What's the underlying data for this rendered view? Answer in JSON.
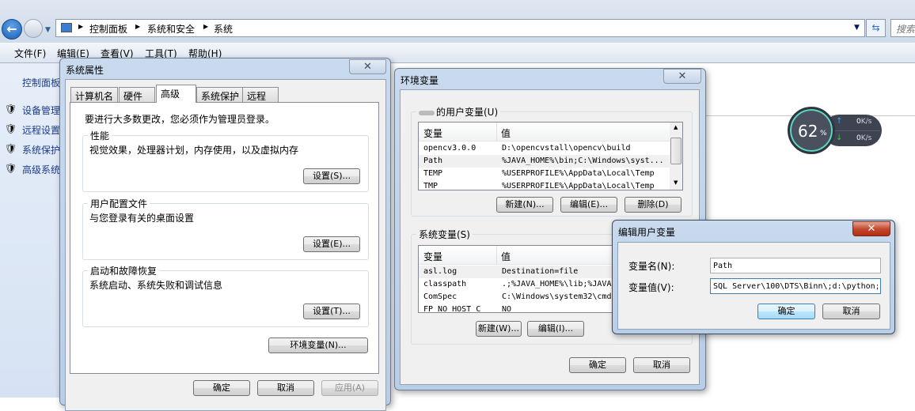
{
  "explorer": {
    "breadcrumb": [
      "控制面板",
      "系统和安全",
      "系统"
    ],
    "search_placeholder": "搜索",
    "menu": [
      "文件(F)",
      "编辑(E)",
      "查看(V)",
      "工具(T)",
      "帮助(H)"
    ],
    "left_pane": {
      "home": "控制面板",
      "items": [
        "设备管理",
        "远程设置",
        "系统保护",
        "高级系统"
      ]
    }
  },
  "net_widget": {
    "cpu_percent": "62",
    "percent_sign": "%",
    "upload": "0",
    "download": "0",
    "unit": "K/s",
    "accent": "#4fd1c5"
  },
  "system_properties": {
    "title": "系统属性",
    "tabs": [
      "计算机名",
      "硬件",
      "高级",
      "系统保护",
      "远程"
    ],
    "selected_tab": "高级",
    "admin_note": "要进行大多数更改，您必须作为管理员登录。",
    "groups": [
      {
        "label": "性能",
        "desc": "视觉效果，处理器计划，内存使用，以及虚拟内存",
        "button": "设置(S)..."
      },
      {
        "label": "用户配置文件",
        "desc": "与您登录有关的桌面设置",
        "button": "设置(E)..."
      },
      {
        "label": "启动和故障恢复",
        "desc": "系统启动、系统失败和调试信息",
        "button": "设置(T)..."
      }
    ],
    "env_button": "环境变量(N)...",
    "ok": "确定",
    "cancel": "取消",
    "apply": "应用(A)"
  },
  "env_vars": {
    "title": "环境变量",
    "user_label": "的用户变量(U)",
    "columns": [
      "变量",
      "值"
    ],
    "user_vars": [
      [
        "opencv3.0.0",
        "D:\\opencvstall\\opencv\\build"
      ],
      [
        "Path",
        "%JAVA_HOME%\\bin;C:\\Windows\\syst..."
      ],
      [
        "TEMP",
        "%USERPROFILE%\\AppData\\Local\\Temp"
      ],
      [
        "TMP",
        "%USERPROFILE%\\AppData\\Local\\Temp"
      ]
    ],
    "user_buttons": [
      "新建(N)...",
      "编辑(E)...",
      "删除(D)"
    ],
    "system_label": "系统变量(S)",
    "system_vars": [
      [
        "asl.log",
        "Destination=file"
      ],
      [
        "classpath",
        ".;%JAVA_HOME%\\lib;%JAVA_"
      ],
      [
        "ComSpec",
        "C:\\Windows\\system32\\cmd."
      ],
      [
        "FP_NO_HOST_C",
        "NO"
      ]
    ],
    "system_buttons": [
      "新建(W)...",
      "编辑(I)..."
    ],
    "ok": "确定",
    "cancel": "取消"
  },
  "edit_var": {
    "title": "编辑用户变量",
    "name_label": "变量名(N):",
    "value_label": "变量值(V):",
    "name_value": "Path",
    "value_value": "SQL Server\\100\\DTS\\Binn\\;d:\\python;%",
    "ok": "确定",
    "cancel": "取消"
  }
}
